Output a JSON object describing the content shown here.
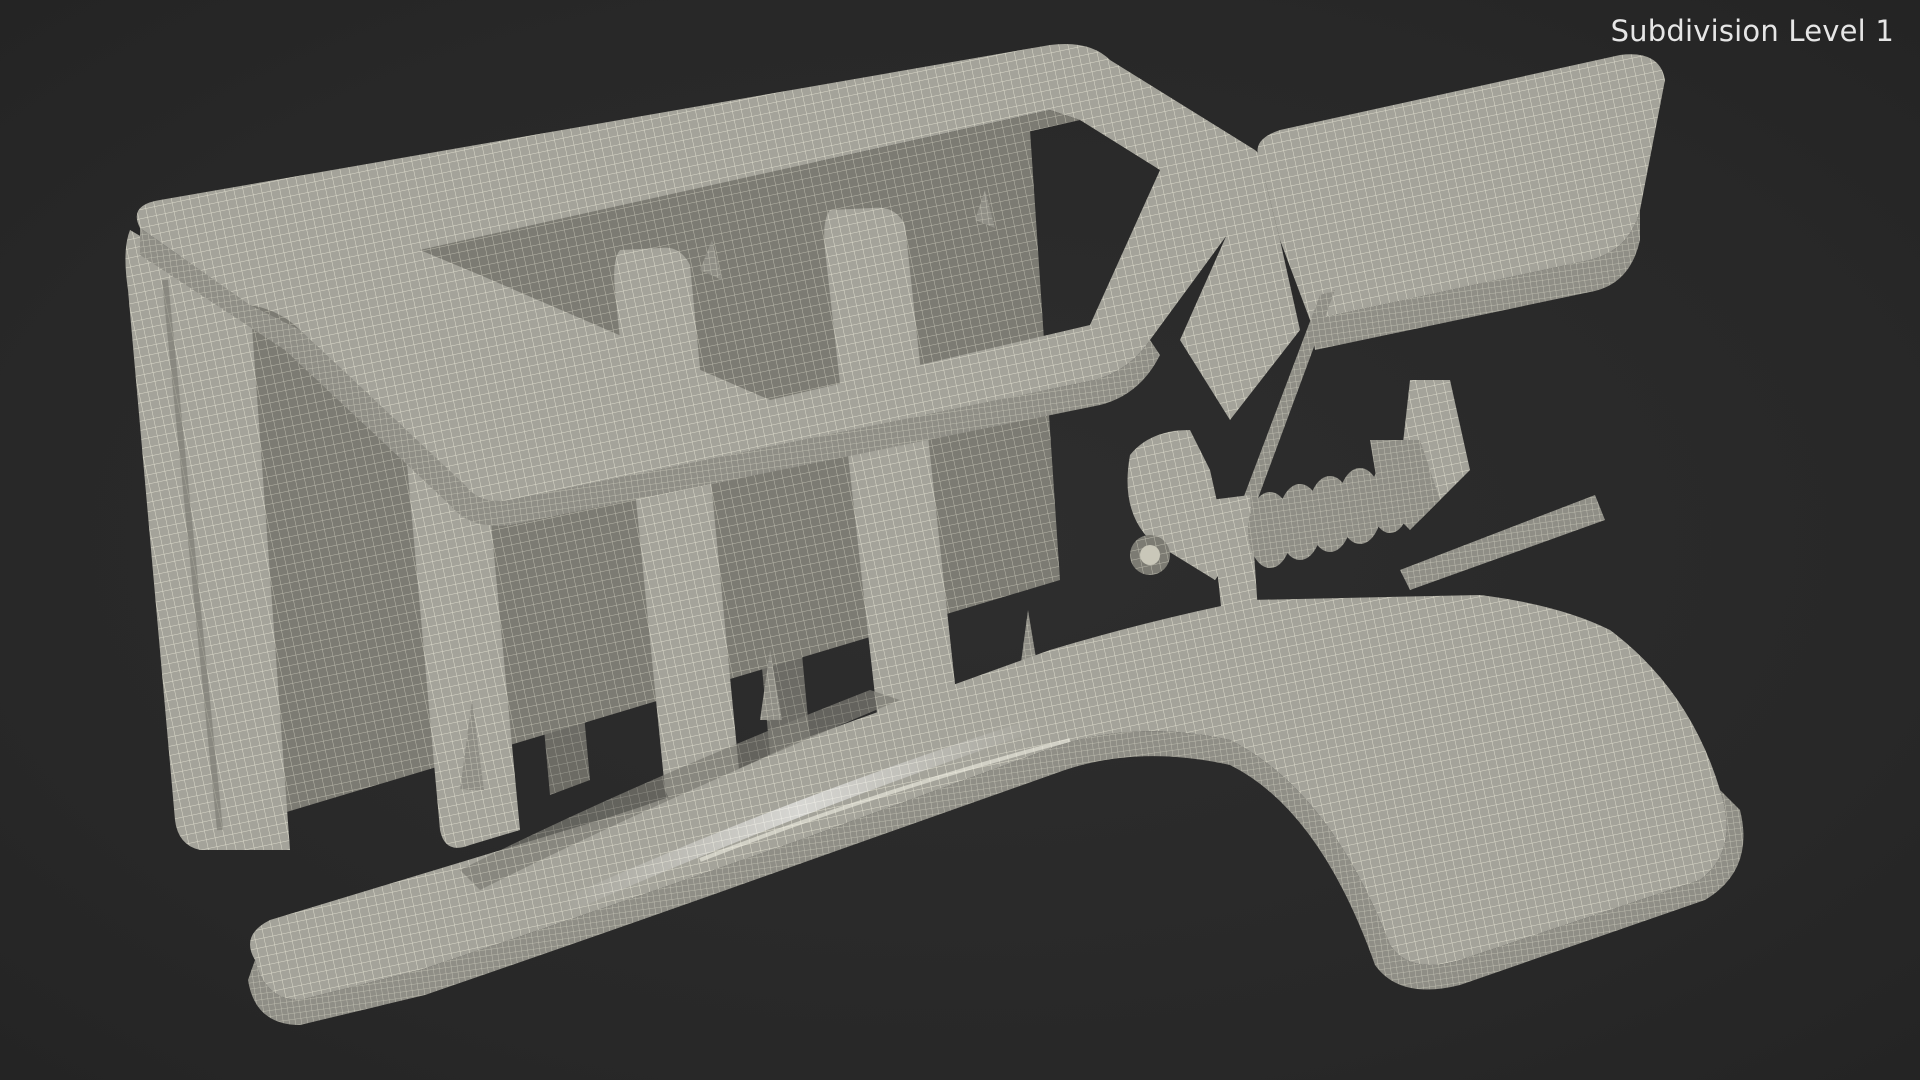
{
  "viewport": {
    "label": "Subdivision Level 1",
    "background_color": "#2a2a2a",
    "model_color": "#9b9a90",
    "wire_color": "#d8d6c8"
  }
}
